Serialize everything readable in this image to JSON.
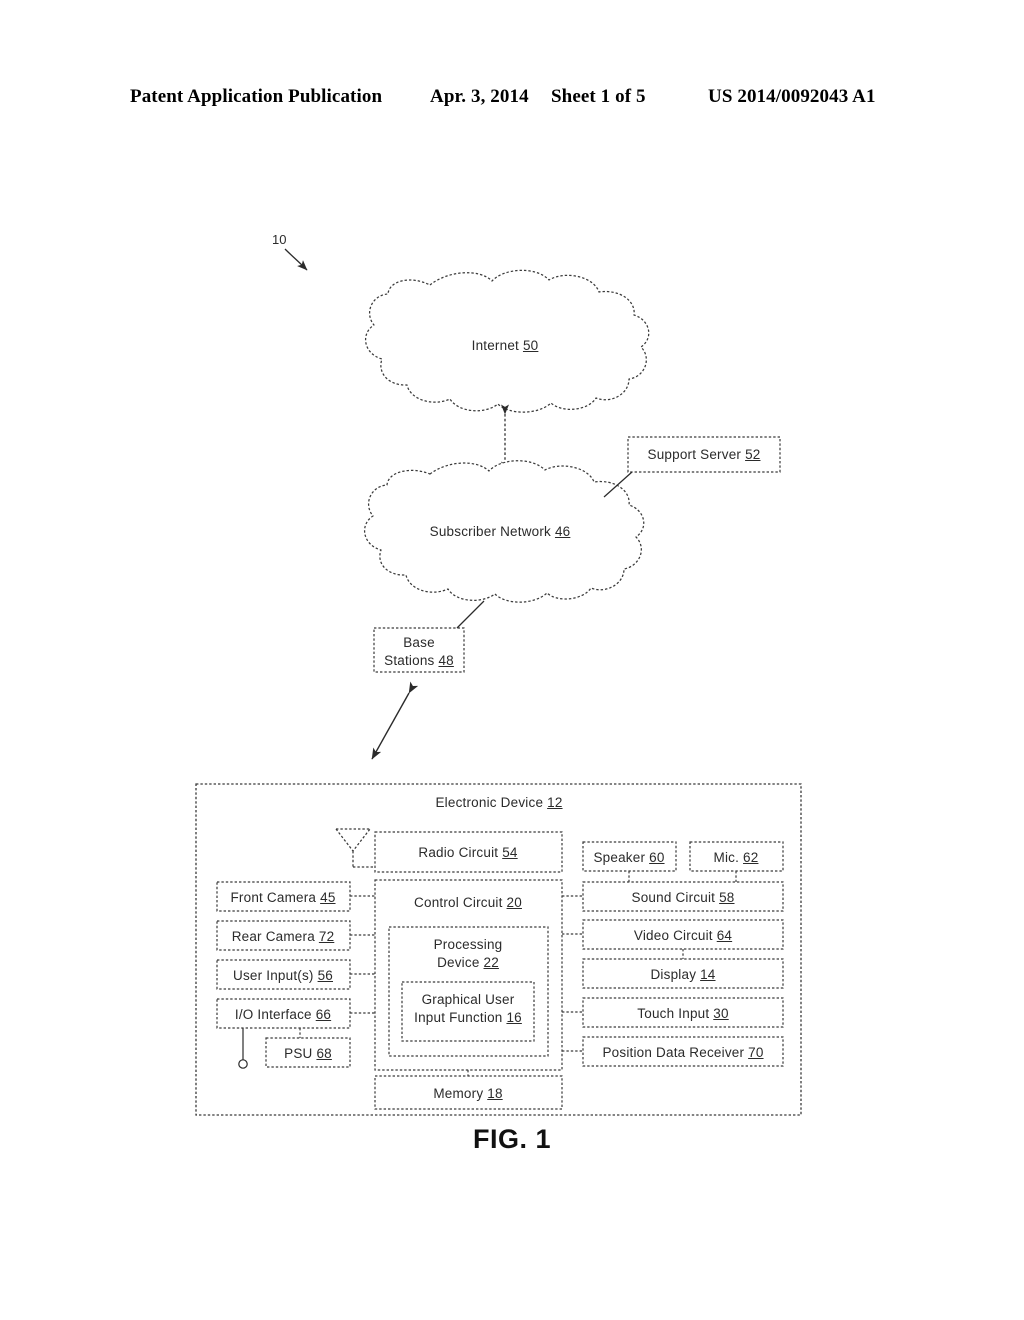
{
  "header": {
    "publication": "Patent Application Publication",
    "date": "Apr. 3, 2014",
    "sheet": "Sheet 1 of 5",
    "patent_number": "US 2014/0092043 A1"
  },
  "figure": {
    "caption": "FIG. 1",
    "system_reference": "10",
    "clouds": [
      {
        "id": "internet",
        "label": "Internet",
        "ref": "50"
      },
      {
        "id": "subscriber-network",
        "label": "Subscriber Network",
        "ref": "46"
      }
    ],
    "network_nodes": [
      {
        "id": "support-server",
        "label": "Support Server",
        "ref": "52"
      },
      {
        "id": "base-stations",
        "line1": "Base",
        "line2": "Stations",
        "ref": "48"
      }
    ],
    "device": {
      "title": "Electronic Device",
      "ref": "12",
      "antenna": "antenna-symbol",
      "blocks": [
        {
          "id": "radio-circuit",
          "label": "Radio Circuit",
          "ref": "54"
        },
        {
          "id": "control-circuit",
          "label": "Control Circuit",
          "ref": "20"
        },
        {
          "id": "processing-device",
          "line1": "Processing",
          "line2": "Device",
          "ref": "22"
        },
        {
          "id": "graphical-user-input-function",
          "line1": "Graphical User",
          "line2": "Input Function",
          "ref": "16"
        },
        {
          "id": "memory",
          "label": "Memory",
          "ref": "18"
        },
        {
          "id": "front-camera",
          "label": "Front Camera",
          "ref": "45"
        },
        {
          "id": "rear-camera",
          "label": "Rear Camera",
          "ref": "72"
        },
        {
          "id": "user-inputs",
          "label": "User Input(s)",
          "ref": "56"
        },
        {
          "id": "io-interface",
          "label": "I/O Interface",
          "ref": "66"
        },
        {
          "id": "psu",
          "label": "PSU",
          "ref": "68"
        },
        {
          "id": "speaker",
          "label": "Speaker",
          "ref": "60"
        },
        {
          "id": "mic",
          "label": "Mic.",
          "ref": "62"
        },
        {
          "id": "sound-circuit",
          "label": "Sound Circuit",
          "ref": "58"
        },
        {
          "id": "video-circuit",
          "label": "Video Circuit",
          "ref": "64"
        },
        {
          "id": "display",
          "label": "Display",
          "ref": "14"
        },
        {
          "id": "touch-input",
          "label": "Touch Input",
          "ref": "30"
        },
        {
          "id": "position-data-receiver",
          "label": "Position Data Receiver",
          "ref": "70"
        }
      ]
    }
  },
  "colors": {
    "ink": "#2b2b2b",
    "page": "#ffffff",
    "header_ink": "#000000"
  }
}
